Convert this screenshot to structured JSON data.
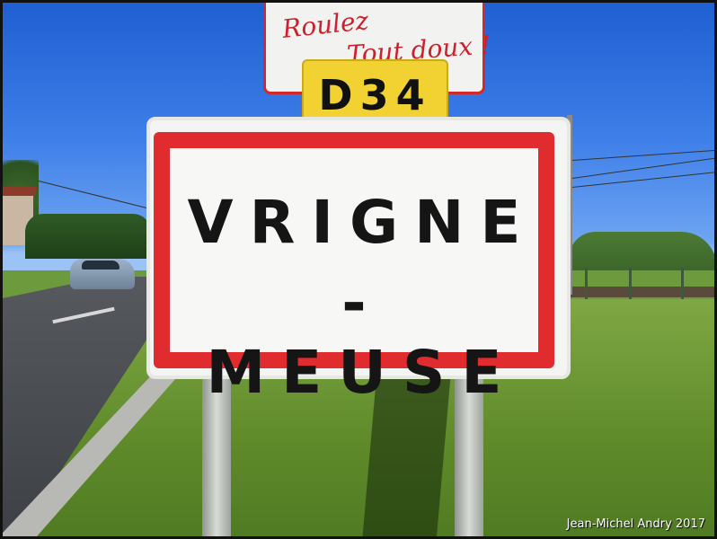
{
  "photo": {
    "upper_sign": {
      "line1": "Roulez",
      "line2": "Tout doux !"
    },
    "route_plate": "D34",
    "town_sign": {
      "line1": "VRIGNE",
      "line2": "-MEUSE"
    },
    "credit": "Jean-Michel Andry 2017"
  },
  "colors": {
    "sky": "#3d7ee8",
    "sign_border": "#e02c2f",
    "route_plate": "#f1d232",
    "grass": "#6d9a3c"
  }
}
